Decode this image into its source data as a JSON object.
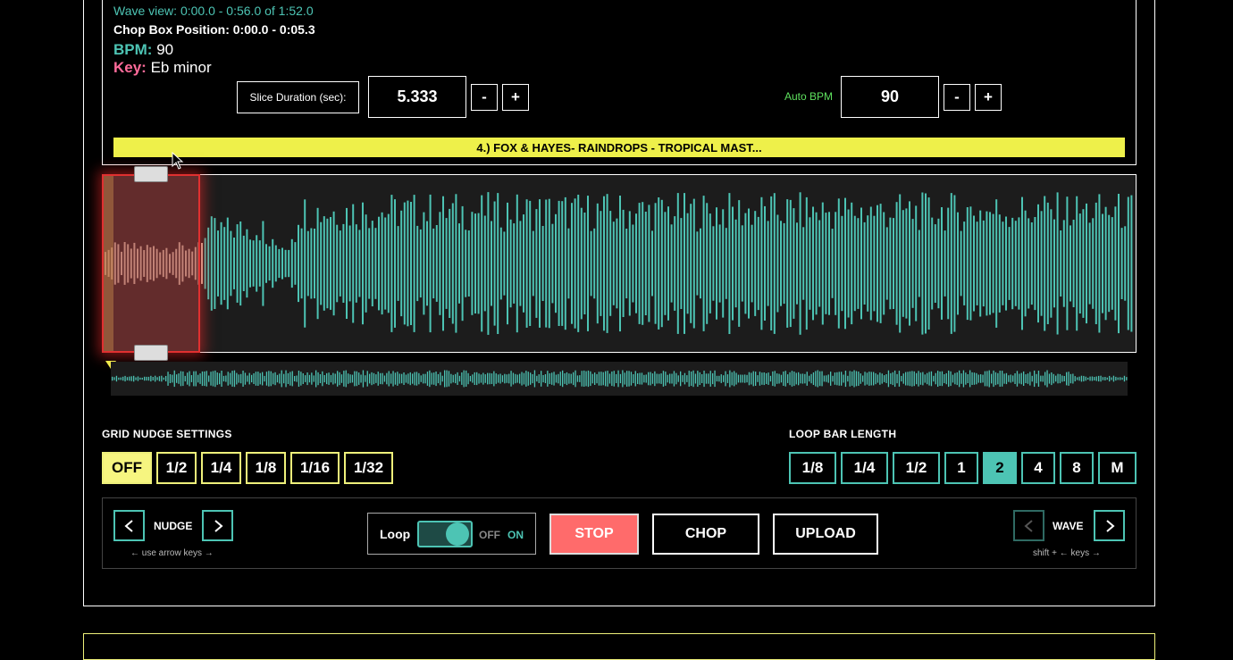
{
  "info": {
    "wave_view": "Wave view: 0:00.0 - 0:56.0 of 1:52.0",
    "chop_box_position": "Chop Box Position: 0:00.0 - 0:05.3",
    "bpm_label": "BPM:",
    "bpm_value": "90",
    "key_label": "Key:",
    "key_value": "Eb minor"
  },
  "slice": {
    "label": "Slice Duration (sec):",
    "value": "5.333",
    "minus": "-",
    "plus": "+"
  },
  "auto_bpm": {
    "label": "Auto BPM",
    "value": "90",
    "minus": "-",
    "plus": "+"
  },
  "track_title": "4.) FOX & HAYES- RAINDROPS - TROPICAL MAST...",
  "grid_nudge": {
    "title": "GRID NUDGE SETTINGS",
    "options": [
      "OFF",
      "1/2",
      "1/4",
      "1/8",
      "1/16",
      "1/32"
    ],
    "active": "OFF"
  },
  "loop_bar": {
    "title": "LOOP BAR LENGTH",
    "options": [
      "1/8",
      "1/4",
      "1/2",
      "1",
      "2",
      "4",
      "8",
      "M"
    ],
    "active": "2"
  },
  "controls": {
    "nudge_label": "NUDGE",
    "nudge_hint": "← use arrow keys →",
    "loop_label": "Loop",
    "toggle_off": "OFF",
    "toggle_on": "ON",
    "stop": "STOP",
    "chop": "CHOP",
    "upload": "UPLOAD",
    "wave_label": "WAVE",
    "wave_hint": "shift + ← keys →"
  },
  "colors": {
    "accent_teal": "#4dc4b4",
    "accent_yellow": "#eef04a",
    "stop_red": "#ff6b6b",
    "chop_box_red": "#e03030"
  },
  "icons": {
    "prev": "chevron-left-icon",
    "next": "chevron-right-icon",
    "playhead": "triangle-down-icon"
  }
}
